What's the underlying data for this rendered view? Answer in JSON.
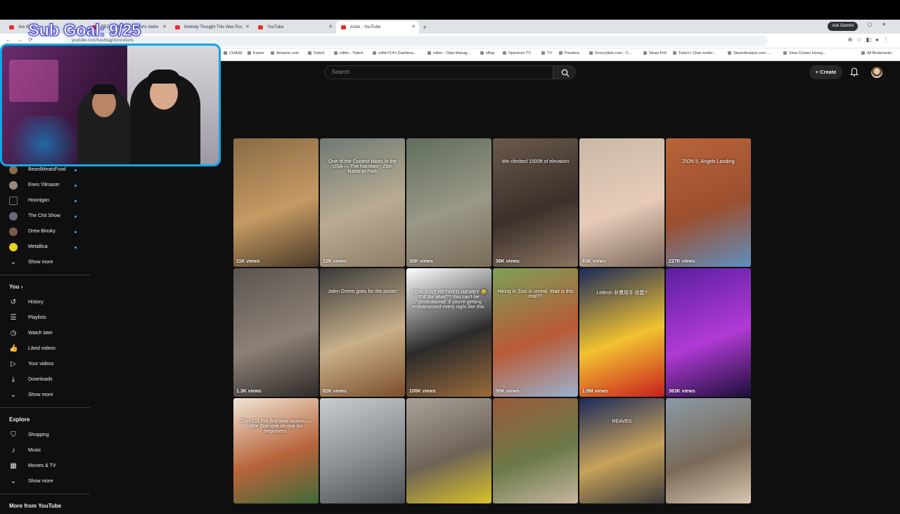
{
  "overlay": {
    "sub_goal": "Sub Goal: 9/25"
  },
  "browser": {
    "tabs": [
      {
        "label": "Are the...",
        "active": false
      },
      {
        "label": "TECKTONIK 🔥 #shorts #edm",
        "active": false
      },
      {
        "label": "Nobody Thought This Was Pos",
        "active": false
      },
      {
        "label": "YouTube",
        "active": false
      },
      {
        "label": "#zion - YouTube",
        "active": true
      }
    ],
    "ask_gemini": "Ask Gemini",
    "url": "youtube.com/hashtag/zion/shorts",
    "bookmarks": [
      "CHASE",
      "Kaiser",
      "Amazon.com",
      "Twitch",
      "rellim - Twitch",
      "rellim714's Dashboa...",
      "rellim - Clips Manag...",
      "eBay",
      "Spectrum TV",
      "TV",
      "Pandora",
      "Groovylists.com - C...",
      "Straw Poll",
      "Twitch | Chat moder...",
      "SteamAnalyst.com -...",
      "Slow Cooker Honey...",
      "All Bookmarks"
    ]
  },
  "header": {
    "search_placeholder": "Search",
    "create_label": "Create"
  },
  "sidebar": {
    "subscriptions": [
      {
        "label": "BeardMeatsFood",
        "dot": true
      },
      {
        "label": "Enes Yilmazer",
        "dot": true
      },
      {
        "label": "Hoonigan",
        "dot": true
      },
      {
        "label": "The Chit Show",
        "dot": true
      },
      {
        "label": "Drew Binsky",
        "dot": true
      },
      {
        "label": "Metallica",
        "dot": true
      }
    ],
    "show_more_1": "Show more",
    "you_title": "You",
    "you_items": [
      {
        "label": "History",
        "icon": "history-icon"
      },
      {
        "label": "Playlists",
        "icon": "playlists-icon"
      },
      {
        "label": "Watch later",
        "icon": "watch-later-icon"
      },
      {
        "label": "Liked videos",
        "icon": "liked-videos-icon"
      },
      {
        "label": "Your videos",
        "icon": "your-videos-icon"
      },
      {
        "label": "Downloads",
        "icon": "downloads-icon"
      }
    ],
    "show_more_2": "Show more",
    "explore_title": "Explore",
    "explore_items": [
      {
        "label": "Shopping",
        "icon": "shopping-icon"
      },
      {
        "label": "Music",
        "icon": "music-icon"
      },
      {
        "label": "Movies & TV",
        "icon": "movies-icon"
      }
    ],
    "show_more_3": "Show more",
    "more_title": "More from YouTube"
  },
  "shorts": [
    {
      "views": "11K views",
      "caption": "",
      "colors": [
        "#8a6b45",
        "#c59a63",
        "#4a3a28"
      ]
    },
    {
      "views": "32K views",
      "caption": "One of the Coolest Hikes in the USA — The Narrows - Zion National Park",
      "colors": [
        "#6e7a73",
        "#b9ab92",
        "#8f7d66"
      ]
    },
    {
      "views": "30K views",
      "caption": "",
      "colors": [
        "#5f6e5c",
        "#9a9886",
        "#7a6b58"
      ]
    },
    {
      "views": "36K views",
      "caption": "We climbed 1500ft of elevation",
      "colors": [
        "#6b5a4a",
        "#3b302a",
        "#8a7360"
      ]
    },
    {
      "views": "83K views",
      "caption": "",
      "colors": [
        "#c9b8a6",
        "#e7cbb8",
        "#7e6a5c"
      ]
    },
    {
      "views": "227K views",
      "caption": "ZION 5. Angels Landing",
      "colors": [
        "#b8643a",
        "#9c4f2f",
        "#5f8fbf"
      ]
    },
    {
      "views": "1.3K views",
      "caption": "",
      "colors": [
        "#5a5550",
        "#8d8177",
        "#2e2a27"
      ]
    },
    {
      "views": "82K views",
      "caption": "Jalen Green goes for the poster",
      "colors": [
        "#3a3a3a",
        "#c8b08a",
        "#7a4d2a"
      ]
    },
    {
      "views": "100K views",
      "caption": "ZION JUST RETIRED WEMBY 😂 7'4\" for what?? You can't be \"generational\" if you're getting embarrassed every night like this.",
      "colors": [
        "#ffffff",
        "#2b2b2b",
        "#9a6a3a"
      ]
    },
    {
      "views": "50K views",
      "caption": "Hiking in Zion is unreal. Wait is this real??",
      "colors": [
        "#7da05a",
        "#b85a35",
        "#9bb2cf"
      ]
    },
    {
      "views": "1.8M views",
      "caption": "LeBron 非慣用手 投籃?",
      "colors": [
        "#1a2a5a",
        "#f2c230",
        "#c81e1e"
      ]
    },
    {
      "views": "363K views",
      "caption": "",
      "colors": [
        "#5a1fa0",
        "#b13ad6",
        "#1c0f38"
      ]
    },
    {
      "views": "",
      "caption": "Zion 101 For first time visitors — little Zion one oh one for beginners.",
      "colors": [
        "#f0e6d6",
        "#b8643a",
        "#3f6b3a"
      ]
    },
    {
      "views": "",
      "caption": "",
      "colors": [
        "#c9cccf",
        "#8a8e92",
        "#4c5054"
      ]
    },
    {
      "views": "",
      "caption": "",
      "colors": [
        "#a9a29a",
        "#6e6356",
        "#d9c22a"
      ]
    },
    {
      "views": "",
      "caption": "",
      "colors": [
        "#9a5a3a",
        "#6b7a4a",
        "#c7b6a0"
      ]
    },
    {
      "views": "",
      "caption": "REAVES",
      "colors": [
        "#1a2a5a",
        "#c8a25a",
        "#3a3a3a"
      ]
    },
    {
      "views": "",
      "caption": "",
      "colors": [
        "#8a9aa8",
        "#7a6a58",
        "#d8c8b0"
      ]
    }
  ]
}
